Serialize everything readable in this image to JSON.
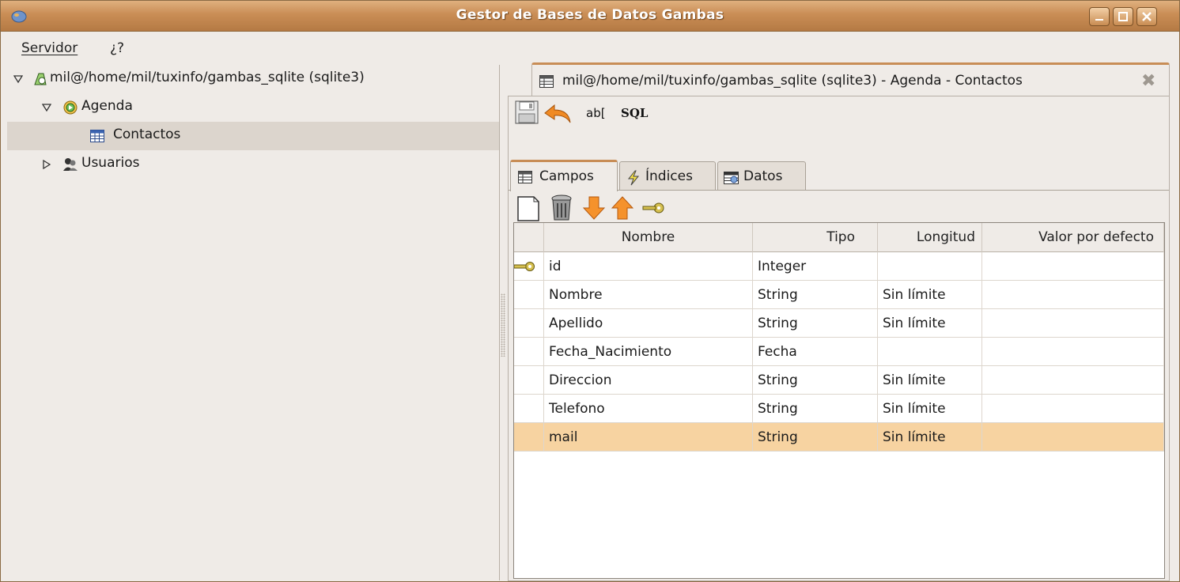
{
  "window": {
    "title": "Gestor de Bases de Datos Gambas"
  },
  "menu": [
    {
      "label": "Servidor"
    },
    {
      "label": "¿?"
    }
  ],
  "tree": {
    "server": "mil@/home/mil/tuxinfo/gambas_sqlite (sqlite3)",
    "database": "Agenda",
    "table": "Contactos",
    "users": "Usuarios"
  },
  "doc_tab": {
    "label": "mil@/home/mil/tuxinfo/gambas_sqlite (sqlite3) - Agenda - Contactos"
  },
  "toolbar": {
    "rename_label": "ab[",
    "sql_label": "SQL"
  },
  "subtabs": [
    {
      "label": "Campos"
    },
    {
      "label": "Índices"
    },
    {
      "label": "Datos"
    }
  ],
  "grid": {
    "columns": [
      "Nombre",
      "Tipo",
      "Longitud",
      "Valor por defecto"
    ],
    "rows": [
      {
        "key": true,
        "nombre": "id",
        "tipo": "Integer",
        "longitud": "",
        "defecto": ""
      },
      {
        "key": false,
        "nombre": "Nombre",
        "tipo": "String",
        "longitud": "Sin límite",
        "defecto": ""
      },
      {
        "key": false,
        "nombre": "Apellido",
        "tipo": "String",
        "longitud": "Sin límite",
        "defecto": ""
      },
      {
        "key": false,
        "nombre": "Fecha_Nacimiento",
        "tipo": "Fecha",
        "longitud": "",
        "defecto": ""
      },
      {
        "key": false,
        "nombre": "Direccion",
        "tipo": "String",
        "longitud": "Sin límite",
        "defecto": ""
      },
      {
        "key": false,
        "nombre": "Telefono",
        "tipo": "String",
        "longitud": "Sin límite",
        "defecto": ""
      },
      {
        "key": false,
        "nombre": "mail",
        "tipo": "String",
        "longitud": "Sin límite",
        "defecto": ""
      }
    ],
    "selected_row": 6
  },
  "colors": {
    "titlebar": "#c98d55",
    "selection": "#f7d3a1",
    "tree_selection": "#dcd5cd"
  }
}
